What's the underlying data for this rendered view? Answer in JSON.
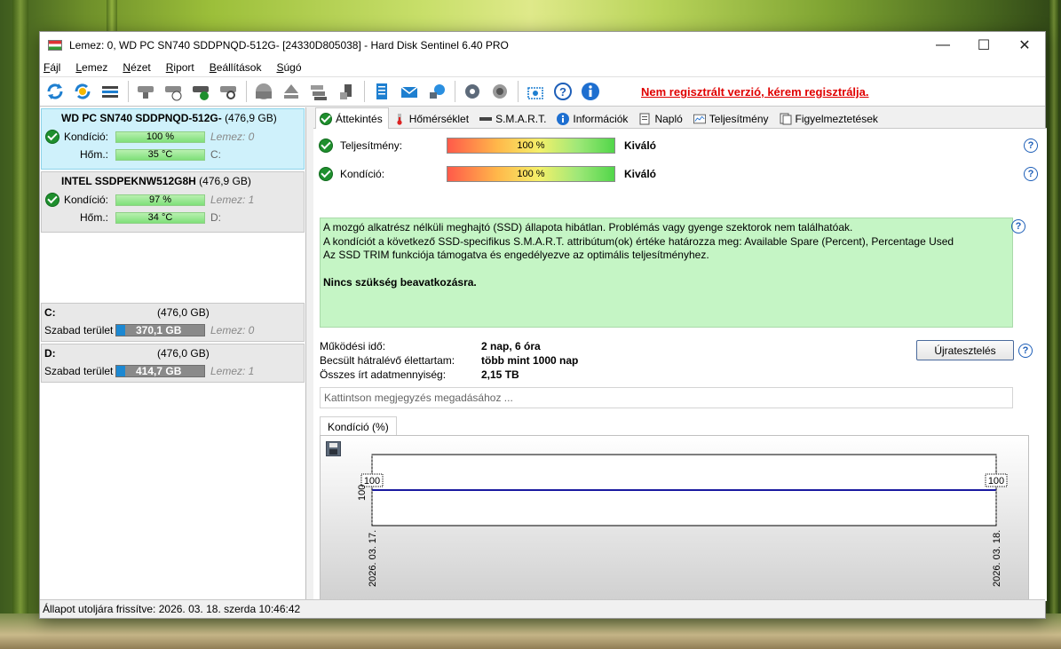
{
  "window": {
    "title": "Lemez: 0, WD PC SN740 SDDPNQD-512G- [24330D805038]  -  Hard Disk Sentinel 6.40 PRO",
    "minimize": "—",
    "maximize": "☐",
    "close": "✕"
  },
  "menu": {
    "items": [
      {
        "label": "Fájl"
      },
      {
        "label": "Lemez"
      },
      {
        "label": "Nézet"
      },
      {
        "label": "Riport"
      },
      {
        "label": "Beállítások"
      },
      {
        "label": "Súgó"
      }
    ]
  },
  "toolbar": {
    "register_link": "Nem regisztrált verzió, kérem regisztrálja."
  },
  "disks": [
    {
      "name": "WD PC SN740 SDDPNQD-512G-",
      "size": "(476,9 GB)",
      "condition_label": "Kondíció:",
      "condition_value": "100 %",
      "condition_side": "Lemez: 0",
      "temp_label": "Hőm.:",
      "temp_value": "35 °C",
      "temp_side": "C:"
    },
    {
      "name": "INTEL SSDPEKNW512G8H",
      "size": "(476,9 GB)",
      "condition_label": "Kondíció:",
      "condition_value": "97 %",
      "condition_side": "Lemez: 1",
      "temp_label": "Hőm.:",
      "temp_value": "34 °C",
      "temp_side": "D:"
    }
  ],
  "partitions": [
    {
      "letter": "C:",
      "size": "(476,0 GB)",
      "free_label": "Szabad terület",
      "free_value": "370,1 GB",
      "disk": "Lemez: 0"
    },
    {
      "letter": "D:",
      "size": "(476,0 GB)",
      "free_label": "Szabad terület",
      "free_value": "414,7 GB",
      "disk": "Lemez: 1"
    }
  ],
  "tabs": [
    {
      "label": "Áttekintés"
    },
    {
      "label": "Hőmérséklet"
    },
    {
      "label": "S.M.A.R.T."
    },
    {
      "label": "Információk"
    },
    {
      "label": "Napló"
    },
    {
      "label": "Teljesítmény"
    },
    {
      "label": "Figyelmeztetések"
    }
  ],
  "overview": {
    "performance_label": "Teljesítmény:",
    "performance_value": "100 %",
    "performance_rating": "Kiváló",
    "condition_label": "Kondíció:",
    "condition_value": "100 %",
    "condition_rating": "Kiváló",
    "info_lines": [
      "A mozgó alkatrész nélküli meghajtó (SSD) állapota hibátlan. Problémás vagy gyenge szektorok nem találhatóak.",
      "A kondíciót a következő SSD-specifikus S.M.A.R.T. attribútum(ok) értéke határozza meg:  Available Spare (Percent), Percentage Used",
      "Az SSD TRIM funkciója támogatva és engedélyezve az optimális teljesítményhez."
    ],
    "info_bold": "Nincs szükség beavatkozásra.",
    "uptime_label": "Működési idő:",
    "uptime_value": "2 nap, 6 óra",
    "lifetime_label": "Becsült hátralévő élettartam:",
    "lifetime_value": "több mint 1000 nap",
    "written_label": "Összes írt adatmennyiség:",
    "written_value": "2,15 TB",
    "retest_button": "Újratesztelés",
    "note_placeholder": "Kattintson megjegyzés megadásához ...",
    "help_glyph": "?"
  },
  "chart_data": {
    "type": "line",
    "title": "Kondíció  (%)",
    "x": [
      "2026. 03. 17.",
      "2026. 03. 18."
    ],
    "series": [
      {
        "values": [
          100,
          100
        ]
      }
    ],
    "ytick": "100",
    "data_labels": [
      "100",
      "100"
    ],
    "ylim": [
      0,
      100
    ],
    "line_color": "#1a1aa0"
  },
  "status": {
    "text": "Állapot utoljára frissítve: 2026. 03. 18. szerda 10:46:42"
  }
}
